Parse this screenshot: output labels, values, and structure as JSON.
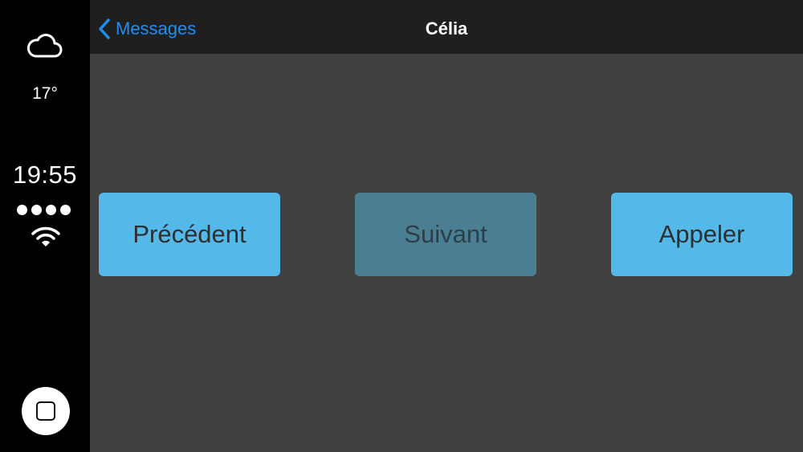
{
  "status": {
    "weather_icon": "cloud-icon",
    "temperature": "17°",
    "time": "19:55",
    "signal_dots": 4,
    "wifi_icon": "wifi-icon"
  },
  "nav": {
    "back_label": "Messages",
    "title": "Célia"
  },
  "actions": {
    "previous_label": "Précédent",
    "next_label": "Suivant",
    "call_label": "Appeler"
  },
  "colors": {
    "accent": "#1f8ef1",
    "button_active": "#54b8e9",
    "button_disabled": "#4a7f93",
    "background": "#414141",
    "navbar": "#1f1f1f"
  }
}
